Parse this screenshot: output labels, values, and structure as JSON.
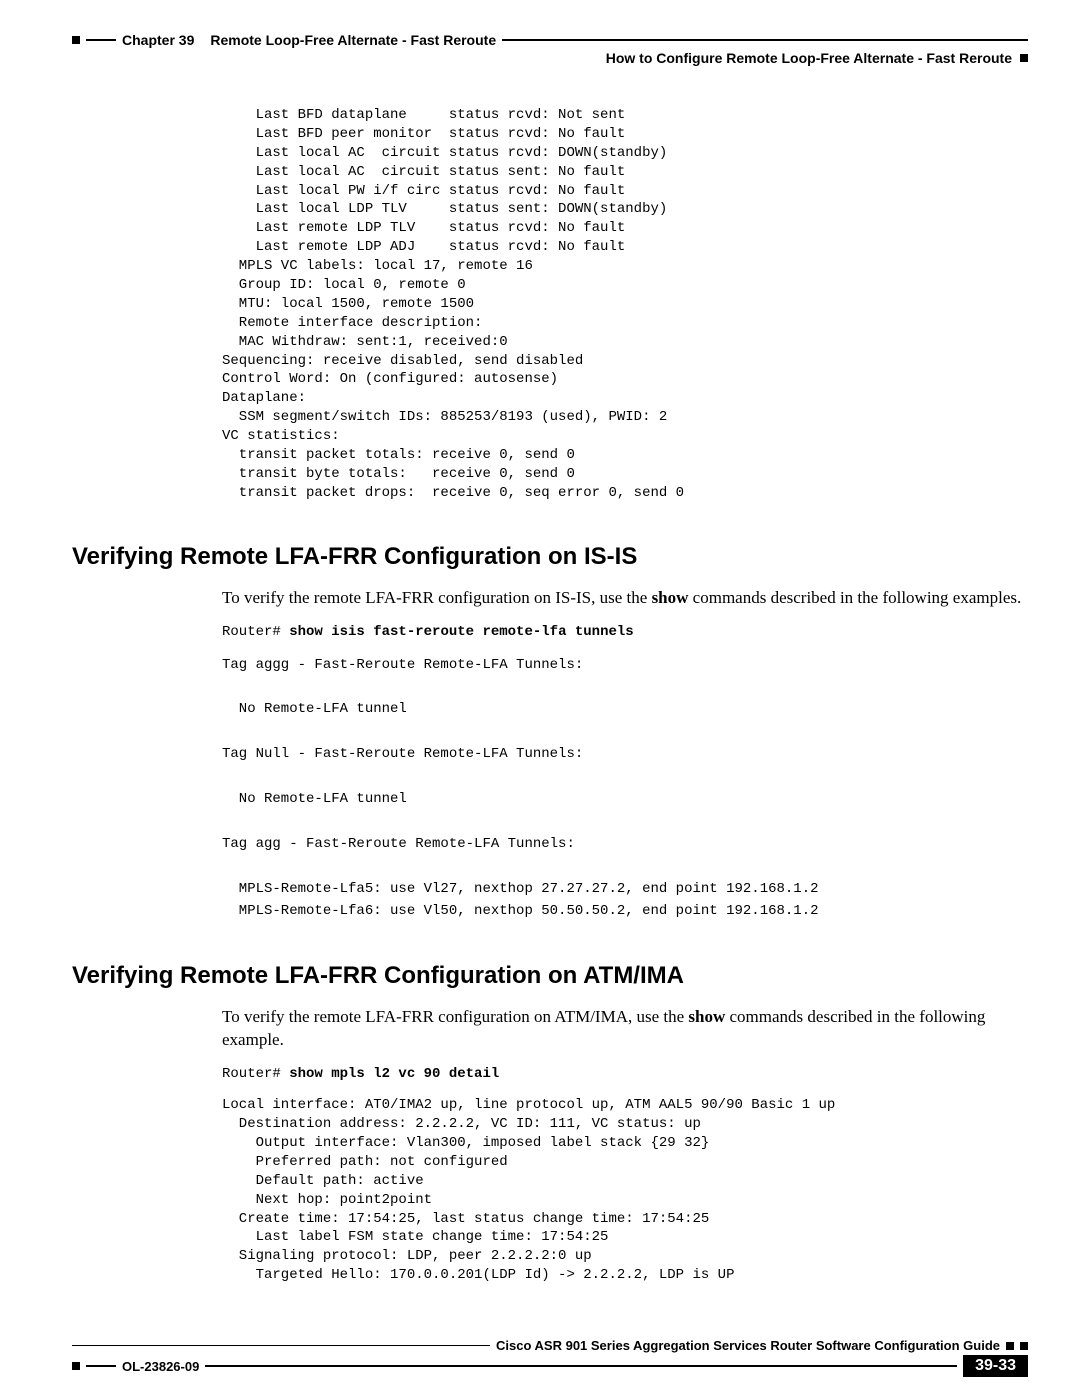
{
  "header": {
    "chapter": "Chapter 39",
    "title": "Remote Loop-Free Alternate - Fast Reroute",
    "subhead": "How to Configure Remote Loop-Free Alternate - Fast Reroute"
  },
  "code_block_top": "    Last BFD dataplane     status rcvd: Not sent\n    Last BFD peer monitor  status rcvd: No fault\n    Last local AC  circuit status rcvd: DOWN(standby)\n    Last local AC  circuit status sent: No fault\n    Last local PW i/f circ status rcvd: No fault\n    Last local LDP TLV     status sent: DOWN(standby)\n    Last remote LDP TLV    status rcvd: No fault\n    Last remote LDP ADJ    status rcvd: No fault\n  MPLS VC labels: local 17, remote 16\n  Group ID: local 0, remote 0\n  MTU: local 1500, remote 1500\n  Remote interface description:\n  MAC Withdraw: sent:1, received:0\nSequencing: receive disabled, send disabled\nControl Word: On (configured: autosense)\nDataplane:\n  SSM segment/switch IDs: 885253/8193 (used), PWID: 2\nVC statistics:\n  transit packet totals: receive 0, send 0\n  transit byte totals:   receive 0, send 0\n  transit packet drops:  receive 0, seq error 0, send 0",
  "section1": {
    "title": "Verifying Remote LFA-FRR Configuration on IS-IS",
    "intro_pre": "To verify the remote LFA-FRR configuration on IS-IS, use the ",
    "intro_bold": "show",
    "intro_post": " commands described in the following examples.",
    "prompt": "Router# ",
    "cmd": "show isis fast-reroute remote-lfa tunnels",
    "output": "Tag aggg - Fast-Reroute Remote-LFA Tunnels:\n\n  No Remote-LFA tunnel\n\nTag Null - Fast-Reroute Remote-LFA Tunnels:\n\n  No Remote-LFA tunnel\n\nTag agg - Fast-Reroute Remote-LFA Tunnels:\n\n  MPLS-Remote-Lfa5: use Vl27, nexthop 27.27.27.2, end point 192.168.1.2\n  MPLS-Remote-Lfa6: use Vl50, nexthop 50.50.50.2, end point 192.168.1.2"
  },
  "section2": {
    "title": "Verifying Remote LFA-FRR Configuration on ATM/IMA",
    "intro_pre": "To verify the remote LFA-FRR configuration on ATM/IMA, use the ",
    "intro_bold": "show",
    "intro_post": " commands described in the following example.",
    "prompt": "Router# ",
    "cmd": "show mpls l2 vc 90 detail",
    "output": "Local interface: AT0/IMA2 up, line protocol up, ATM AAL5 90/90 Basic 1 up\n  Destination address: 2.2.2.2, VC ID: 111, VC status: up\n    Output interface: Vlan300, imposed label stack {29 32}\n    Preferred path: not configured\n    Default path: active\n    Next hop: point2point\n  Create time: 17:54:25, last status change time: 17:54:25\n    Last label FSM state change time: 17:54:25\n  Signaling protocol: LDP, peer 2.2.2.2:0 up\n    Targeted Hello: 170.0.0.201(LDP Id) -> 2.2.2.2, LDP is UP"
  },
  "footer": {
    "guide": "Cisco ASR 901 Series Aggregation Services Router Software Configuration Guide",
    "docnum": "OL-23826-09",
    "pagenum": "39-33"
  }
}
